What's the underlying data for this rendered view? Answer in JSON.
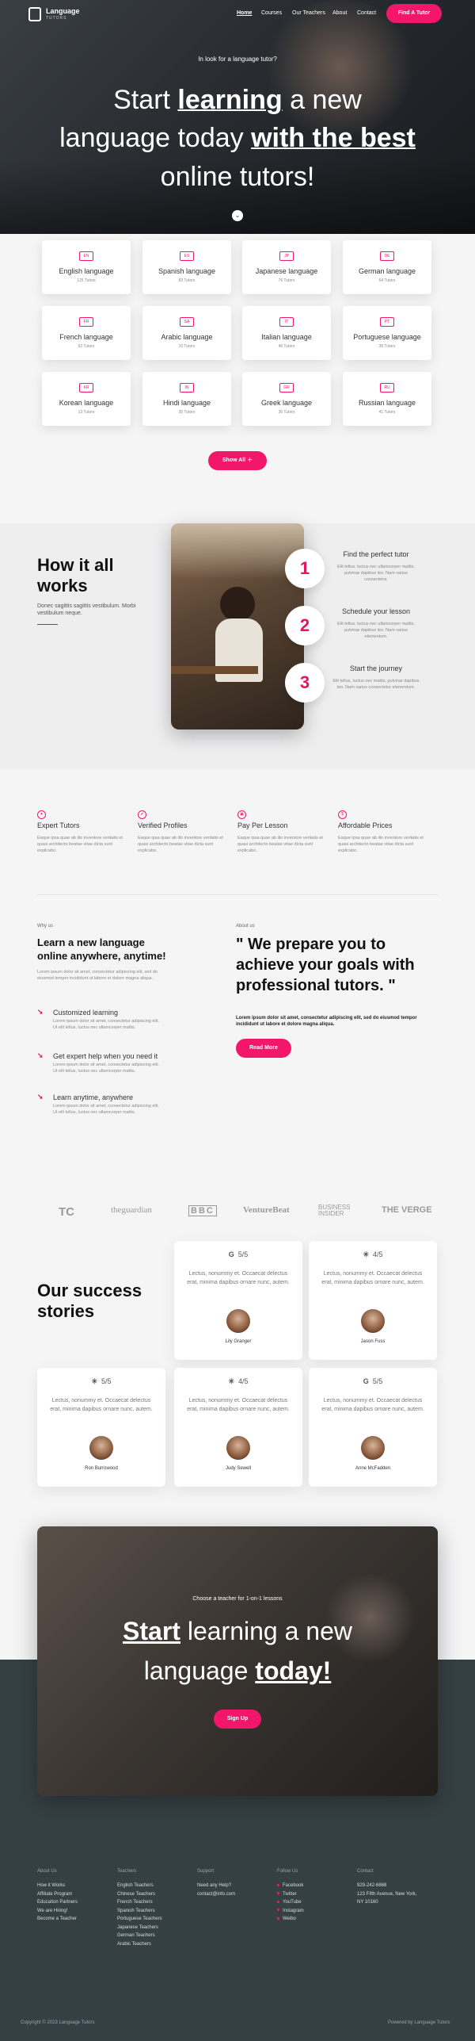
{
  "header": {
    "logo_title": "Language",
    "logo_sub": "TUTORS",
    "nav": [
      {
        "label": "Home",
        "active": true
      },
      {
        "label": "Courses"
      },
      {
        "label": "Our Teachers"
      },
      {
        "label": "About"
      },
      {
        "label": "Contact"
      }
    ],
    "cta": "Find A Tutor"
  },
  "hero": {
    "kicker": "In look for a language tutor?",
    "line1_a": "Start ",
    "line1_b": "learning",
    "line1_c": " a new",
    "line2_a": "language today ",
    "line2_b": "with the best",
    "line3": "online tutors!"
  },
  "languages": [
    {
      "code": "EN",
      "name": "English language",
      "tutors": "125 Tutors"
    },
    {
      "code": "ES",
      "name": "Spanish language",
      "tutors": "83 Tutors"
    },
    {
      "code": "JP",
      "name": "Japanese language",
      "tutors": "76 Tutors"
    },
    {
      "code": "DE",
      "name": "German language",
      "tutors": "64 Tutors"
    },
    {
      "code": "FR",
      "name": "French language",
      "tutors": "92 Tutors"
    },
    {
      "code": "SA",
      "name": "Arabic language",
      "tutors": "10 Tutors"
    },
    {
      "code": "IT",
      "name": "Italian language",
      "tutors": "46 Tutors"
    },
    {
      "code": "PT",
      "name": "Portuguese language",
      "tutors": "35 Tutors"
    },
    {
      "code": "KR",
      "name": "Korean language",
      "tutors": "13 Tutors"
    },
    {
      "code": "IN",
      "name": "Hindi language",
      "tutors": "35 Tutors"
    },
    {
      "code": "GR",
      "name": "Greek language",
      "tutors": "36 Tutors"
    },
    {
      "code": "RU",
      "name": "Russian language",
      "tutors": "41 Tutors"
    }
  ],
  "show_all": "Show All",
  "how": {
    "title_1": "How it all",
    "title_2": "works",
    "desc": "Donec sagittis sagittis vestibulum. Morbi vestibulum neque.",
    "steps": [
      {
        "num": "1",
        "title": "Find the perfect tutor",
        "desc": "Elit tellus, luctus nec ullamcorper mattis, pulvinar dapibus leo. Nam varius consectetur."
      },
      {
        "num": "2",
        "title": "Schedule your lesson",
        "desc": "Elit tellus, luctus nec ullamcorper mattis, pulvinar dapibus leo. Nam varius elementum."
      },
      {
        "num": "3",
        "title": "Start the journey",
        "desc": "Elit tellus, luctus nec mattis, pulvinar dapibus leo. Nam varius consectetur elementum."
      }
    ]
  },
  "features": [
    {
      "title": "Expert Tutors",
      "desc": "Eaque ipsa quae ab illo inventore veritatis et quasi architecto beatae vitae dicta sunt explicabo."
    },
    {
      "title": "Verified Profiles",
      "desc": "Eaque ipsa quae ab illo inventore veritatis et quasi architecto beatae vitae dicta sunt explicabo."
    },
    {
      "title": "Pay Per Lesson",
      "desc": "Eaque ipsa quae ab illo inventore veritatis et quasi architecto beatae vitae dicta sunt explicabo."
    },
    {
      "title": "Affordable Prices",
      "desc": "Eaque ipsa quae ab illo inventore veritatis et quasi architecto beatae vitae dicta sunt explicabo."
    }
  ],
  "why": {
    "label": "Why us",
    "title": "Learn a new language online anywhere, anytime!",
    "desc": "Lorem ipsum dolor sit amet, consectetur adipiscing elit, sed do eiusmod tempor incididunt ut labore et dolore magna aliqua.",
    "bullets": [
      {
        "title": "Customized learning",
        "desc": "Lorem ipsum dolor sit amet, consectetur adipiscing elit. Ut elit tellus, luctus nec ullamcorper mattis."
      },
      {
        "title": "Get expert help when you need it",
        "desc": "Lorem ipsum dolor sit amet, consectetur adipiscing elit. Ut elit tellus, luctus nec ullamcorper mattis."
      },
      {
        "title": "Learn anytime, anywhere",
        "desc": "Lorem ipsum dolor sit amet, consectetur adipiscing elit. Ut elit tellus, luctus nec ullamcorper mattis."
      }
    ]
  },
  "about": {
    "label": "About us",
    "quote": "\" We prepare you to achieve your goals with professional tutors. \"",
    "desc": "Lorem ipsum dolor sit amet, consectetur adipiscing elit, sed do eiusmod tempor incididunt ut labore et dolore magna aliqua.",
    "cta": "Read More"
  },
  "brands": [
    "TC",
    "theguardian",
    "BBC",
    "VentureBeat",
    "BUSINESS INSIDER",
    "THE VERGE"
  ],
  "success": {
    "title_1": "Our success",
    "title_2": "stories",
    "reviews": [
      {
        "source": "G",
        "rating": "5/5",
        "quote": "Lectus, nonummy et. Occaecat delectus erat, minima dapibus ornare nunc, autem.",
        "name": "Lily Granger"
      },
      {
        "source": "✳",
        "rating": "4/5",
        "quote": "Lectus, nonummy et. Occaecat delectus erat, minima dapibus ornare nunc, autem.",
        "name": "Jason Fuss"
      },
      {
        "source": "✳",
        "rating": "5/5",
        "quote": "Lectus, nonummy et. Occaecat delectus erat, minima dapibus ornare nunc, autem.",
        "name": "Ron Burrowood"
      },
      {
        "source": "✳",
        "rating": "4/5",
        "quote": "Lectus, nonummy et. Occaecat delectus erat, minima dapibus ornare nunc, autem.",
        "name": "Judy Sewell"
      },
      {
        "source": "G",
        "rating": "5/5",
        "quote": "Lectus, nonummy et. Occaecat delectus erat, minima dapibus ornare nunc, autem.",
        "name": "Anne McFadden"
      }
    ]
  },
  "cta_section": {
    "kicker": "Choose a teacher for 1-on-1 lessons",
    "line1_a": "Start",
    "line1_b": " learning a new",
    "line2_a": "language ",
    "line2_b": "today!",
    "button": "Sign Up"
  },
  "footer": {
    "cols": [
      {
        "title": "About Us",
        "links": [
          "How it Works",
          "Affiliate Program",
          "Education Partners",
          "We are Hiring!",
          "Become a Teacher"
        ]
      },
      {
        "title": "Teachers",
        "links": [
          "English Teachers",
          "Chinese Teachers",
          "French Teachers",
          "Spanish Teachers",
          "Portuguese Teachers",
          "Japanese Teachers",
          "German Teachers",
          "Arabic Teachers"
        ]
      },
      {
        "title": "Support",
        "links": [
          "Need any Help?",
          "contact@info.com"
        ]
      },
      {
        "title": "Follow Us",
        "links": [
          "Facebook",
          "Twitter",
          "YouTube",
          "Instagram",
          "Weibo"
        ]
      },
      {
        "title": "Contact",
        "links": [
          "929-242-6868",
          "123 Fifth Avenue, New York,",
          "NY 10160"
        ]
      }
    ],
    "copyright": "Copyright © 2023 Language Tutors",
    "powered": "Powered by Language Tutors"
  },
  "colors": {
    "accent": "#f2176b",
    "footer": "#354045"
  }
}
